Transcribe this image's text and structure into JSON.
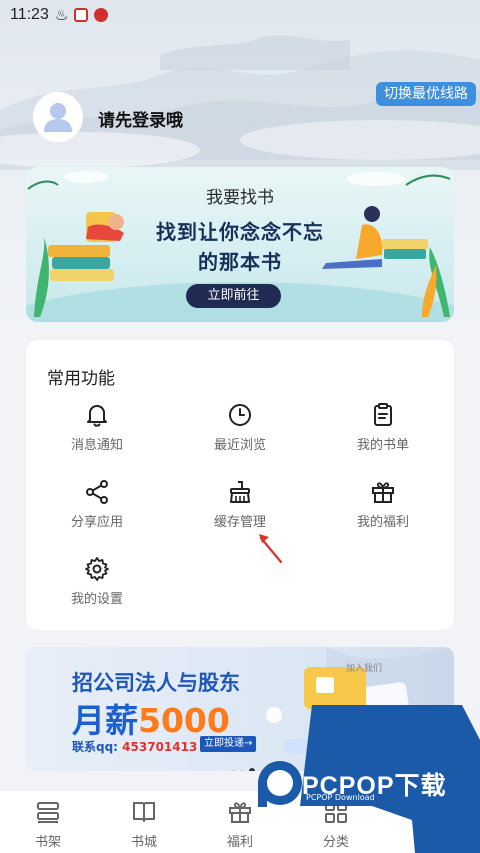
{
  "status_bar": {
    "time": "11:23",
    "icons": [
      "fire-icon",
      "weibo-red-icon",
      "app-red-icon"
    ]
  },
  "header": {
    "switch_line_label": "切换最优线路",
    "login_prompt": "请先登录哦",
    "avatar_icon": "user-avatar-icon"
  },
  "banner": {
    "subtitle": "我要找书",
    "title_line1": "找到让你念念不忘",
    "title_line2": "的那本书",
    "button_label": "立即前往"
  },
  "functions": {
    "title": "常用功能",
    "items": [
      {
        "label": "消息通知",
        "icon": "bell-icon"
      },
      {
        "label": "最近浏览",
        "icon": "clock-icon"
      },
      {
        "label": "我的书单",
        "icon": "clipboard-icon"
      },
      {
        "label": "分享应用",
        "icon": "share-icon"
      },
      {
        "label": "缓存管理",
        "icon": "broom-icon"
      },
      {
        "label": "我的福利",
        "icon": "gift-icon"
      },
      {
        "label": "我的设置",
        "icon": "gear-icon"
      }
    ]
  },
  "ad": {
    "line1": "招公司法人与股东",
    "line2_prefix": "月薪",
    "line2_number": "5000",
    "contact_label": "联系qq: ",
    "contact_qq": "453701413",
    "cta": "立即投递→",
    "join_label": "加入我们"
  },
  "bottom_nav": {
    "items": [
      {
        "label": "书架",
        "icon": "bookshelf-icon"
      },
      {
        "label": "书城",
        "icon": "book-icon"
      },
      {
        "label": "福利",
        "icon": "gift-icon"
      },
      {
        "label": "分类",
        "icon": "grid-icon"
      }
    ]
  },
  "watermark": {
    "text": "PCPOP下载",
    "sub": "PCPOP Download"
  },
  "colors": {
    "accent_blue": "#3f8fdf",
    "banner_button": "#1f2b52",
    "ad_orange": "#ff7a1a",
    "annotation_red": "#e0312b"
  }
}
